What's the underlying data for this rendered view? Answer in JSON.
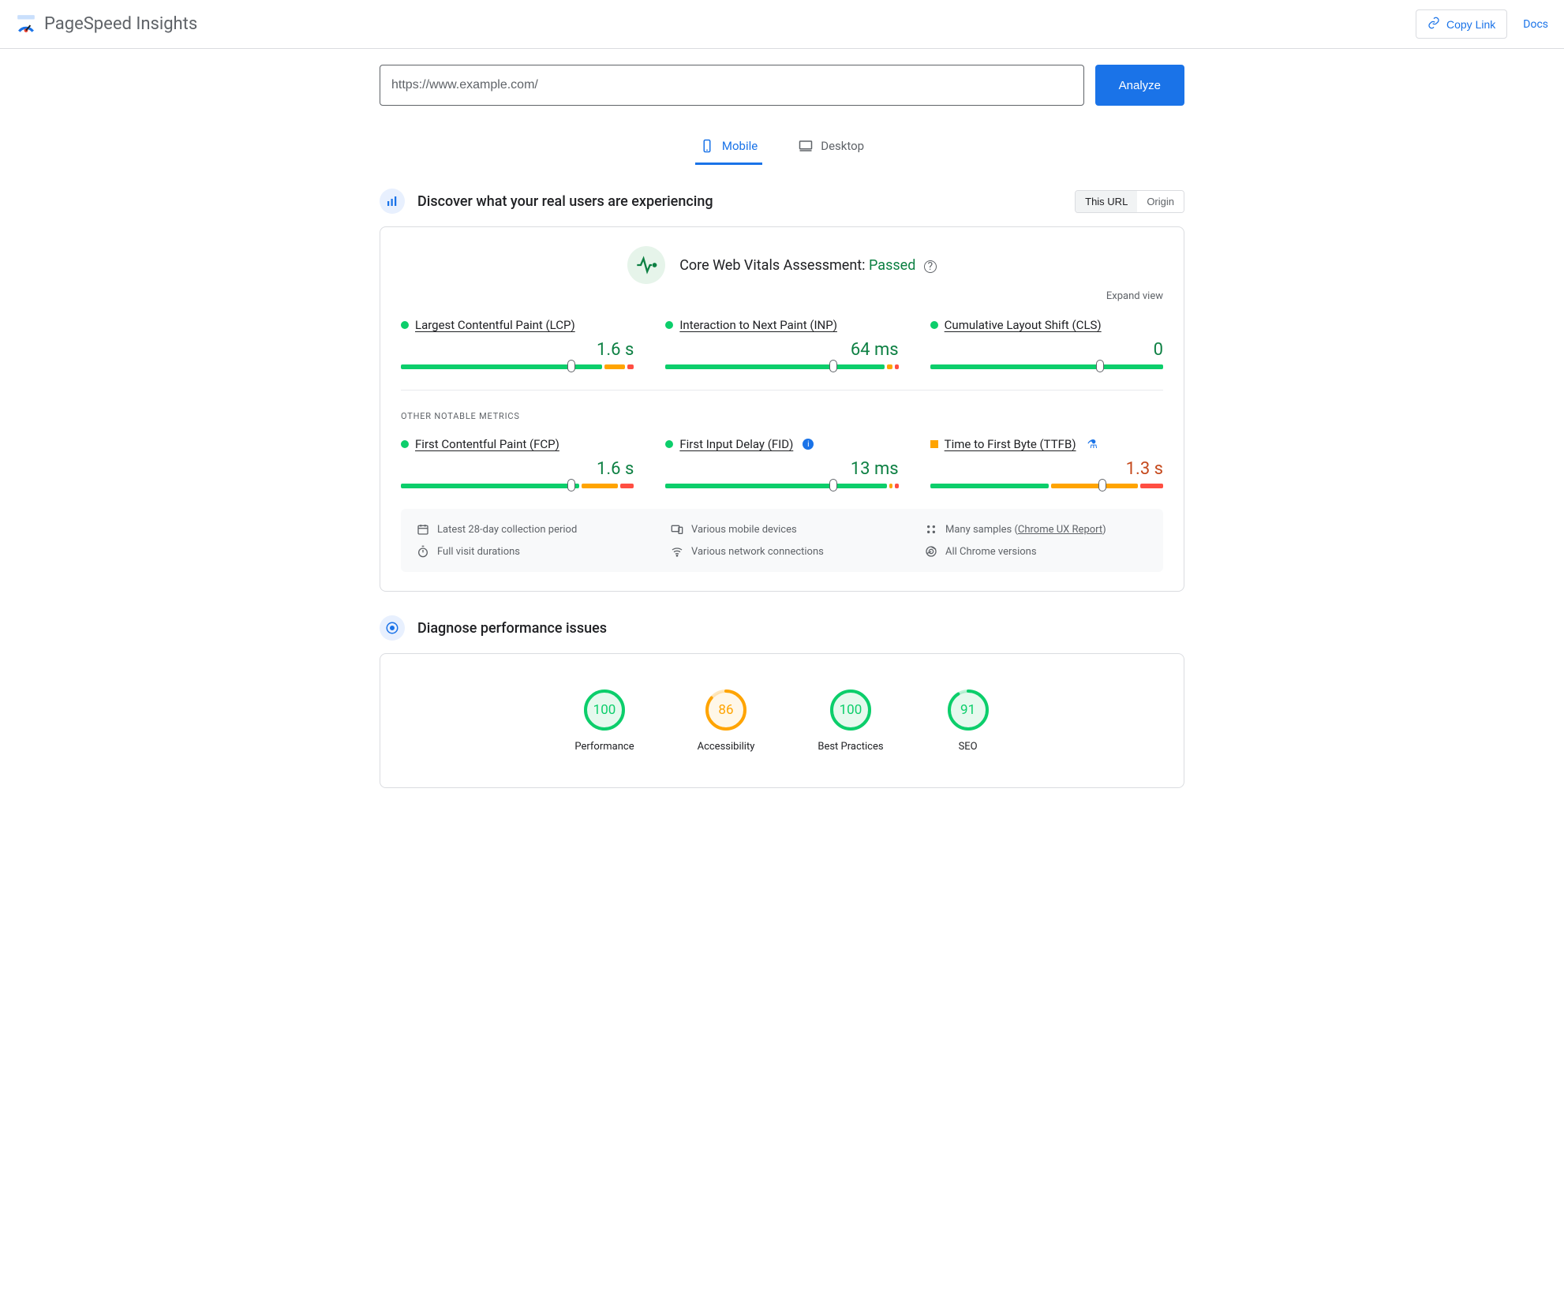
{
  "header": {
    "title": "PageSpeed Insights",
    "copy_link": "Copy Link",
    "docs": "Docs"
  },
  "search": {
    "url": "https://www.example.com/",
    "analyze": "Analyze"
  },
  "tabs": {
    "mobile": "Mobile",
    "desktop": "Desktop"
  },
  "discover": {
    "title": "Discover what your real users are experiencing",
    "toggle": {
      "this_url": "This URL",
      "origin": "Origin"
    },
    "assessment_label": "Core Web Vitals Assessment: ",
    "assessment_result": "Passed",
    "expand": "Expand view",
    "metrics": [
      {
        "name": "Largest Contentful Paint (LCP)",
        "value": "1.6 s",
        "status": "green",
        "marker": 73,
        "segs": [
          88,
          9,
          3
        ]
      },
      {
        "name": "Interaction to Next Paint (INP)",
        "value": "64 ms",
        "status": "green",
        "marker": 72,
        "segs": [
          96,
          2.5,
          1.5
        ]
      },
      {
        "name": "Cumulative Layout Shift (CLS)",
        "value": "0",
        "status": "green",
        "marker": 73,
        "segs": [
          100,
          0,
          0
        ]
      }
    ],
    "other_label": "OTHER NOTABLE METRICS",
    "other_metrics": [
      {
        "name": "First Contentful Paint (FCP)",
        "value": "1.6 s",
        "status": "green",
        "marker": 73,
        "segs": [
          78,
          16,
          6
        ],
        "badge": ""
      },
      {
        "name": "First Input Delay (FID)",
        "value": "13 ms",
        "status": "green",
        "marker": 72,
        "segs": [
          97,
          1.5,
          1.5
        ],
        "badge": "info"
      },
      {
        "name": "Time to First Byte (TTFB)",
        "value": "1.3 s",
        "status": "orange",
        "marker": 74,
        "segs": [
          52,
          38,
          10
        ],
        "badge": "flask"
      }
    ],
    "footer": {
      "period": "Latest 28-day collection period",
      "devices": "Various mobile devices",
      "samples_prefix": "Many samples (",
      "samples_link": "Chrome UX Report",
      "samples_suffix": ")",
      "durations": "Full visit durations",
      "networks": "Various network connections",
      "versions": "All Chrome versions"
    }
  },
  "diagnose": {
    "title": "Diagnose performance issues",
    "scores": [
      {
        "label": "Performance",
        "value": "100",
        "pct": 100,
        "color": "#0cce6b",
        "fill": "#e6f9ee"
      },
      {
        "label": "Accessibility",
        "value": "86",
        "pct": 86,
        "color": "#ffa400",
        "fill": "#fff7e8"
      },
      {
        "label": "Best Practices",
        "value": "100",
        "pct": 100,
        "color": "#0cce6b",
        "fill": "#e6f9ee"
      },
      {
        "label": "SEO",
        "value": "91",
        "pct": 91,
        "color": "#0cce6b",
        "fill": "#e6f9ee"
      }
    ]
  }
}
